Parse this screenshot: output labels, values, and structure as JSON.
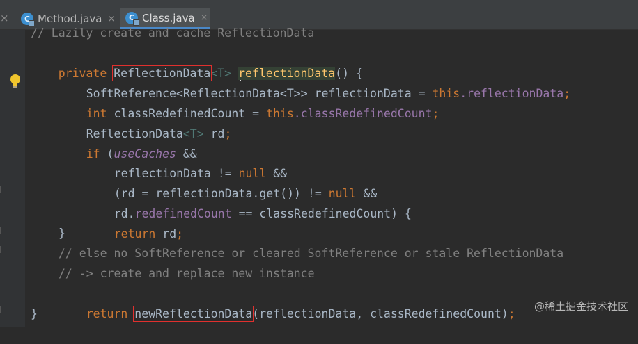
{
  "tabs": [
    {
      "label": "Method.java",
      "icon": "class-file-icon",
      "active": false
    },
    {
      "label": "Class.java",
      "icon": "class-file-icon",
      "active": true
    }
  ],
  "close_glyph": "×",
  "code": {
    "l0": "// Lazily create and cache ReflectionData",
    "l1": {
      "private": "private",
      "type": "ReflectionData",
      "generic": "<T>",
      "name": "reflectionData",
      "rest": "() {"
    },
    "l2": {
      "type": "SoftReference<ReflectionData<T>>",
      "var": " reflectionData = ",
      "this": "this",
      "field": ".reflectionData",
      "semi": ";"
    },
    "l3": {
      "int": "int",
      "var": " classRedefinedCount = ",
      "this": "this",
      "field": ".classRedefinedCount",
      "semi": ";"
    },
    "l4": {
      "type": "ReflectionData",
      "generic": "<T>",
      "var": " rd",
      "semi": ";"
    },
    "l5": {
      "if": "if",
      "paren": " (",
      "static": "useCaches",
      "rest": " &&"
    },
    "l6": {
      "var": "reflectionData != ",
      "null": "null",
      "rest": " &&"
    },
    "l7": {
      "var": "(rd = reflectionData.get()) != ",
      "null": "null",
      "rest": " &&"
    },
    "l8": {
      "var": "rd.",
      "field": "redefinedCount",
      "rest": " == classRedefinedCount) {"
    },
    "l9": {
      "return": "return",
      "var": " rd",
      "semi": ";"
    },
    "l10": "}",
    "l11": "// else no SoftReference or cleared SoftReference or stale ReflectionData",
    "l12": "// -> create and replace new instance",
    "l13": {
      "return": "return",
      "method": "newReflectionData",
      "args": "(reflectionData, classRedefinedCount)",
      "semi": ";"
    },
    "l14": "}"
  },
  "watermark": "@稀土掘金技术社区",
  "colors": {
    "keyword": "#cc7832",
    "comment": "#808080",
    "field": "#9876aa",
    "method": "#ffc66d",
    "text": "#a9b7c6",
    "highlight_box": "#e0302e"
  }
}
